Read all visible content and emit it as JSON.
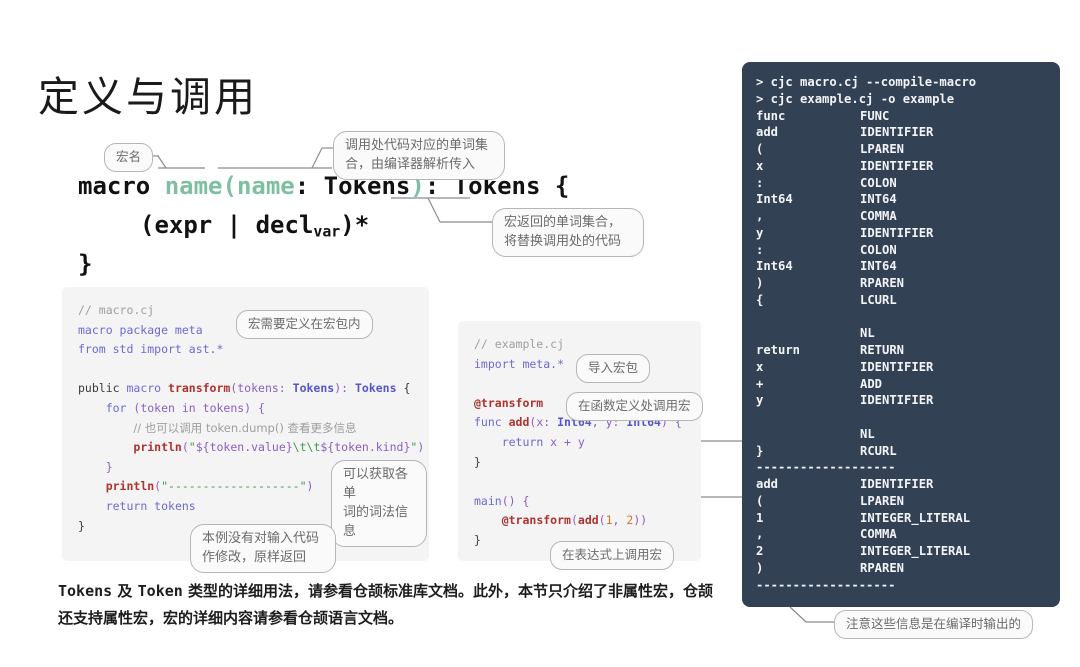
{
  "slide": {
    "title": "定义与调用",
    "background": "#ffffff"
  },
  "colors": {
    "accent_green": "#7dbfa0",
    "terminal_bg": "#334155",
    "code_panel_bg": "#f4f4f5",
    "callout_border": "#b6b6b6",
    "callout_text": "#6b6b6b"
  },
  "signature": {
    "line1": {
      "kw": "macro ",
      "name": "name",
      "lparen": "(",
      "param": "name",
      "colon": ": ",
      "type": "Tokens",
      "rparen": ")",
      "ret": ": ",
      "rettype": "Tokens",
      "brace": " {"
    },
    "line2_prefix": "(expr | decl",
    "line2_sub": "var",
    "line2_suffix": ")*",
    "line3": "}"
  },
  "callouts": {
    "macro_name": "宏名",
    "tokens_param": "调用处代码对应的单词集\n合，由编译器解析传入",
    "tokens_return": "宏返回的单词集合，\n将替换调用处的代码",
    "macro_package": "宏需要定义在宏包内",
    "token_lexinfo": "可以获取各单\n词的词法信息",
    "return_unchanged": "本例没有对输入代码\n作修改，原样返回",
    "import_pkg": "导入宏包",
    "call_at_funcdef": "在函数定义处调用宏",
    "call_at_expr": "在表达式上调用宏",
    "compile_time_note": "注意这些信息是在编译时输出的"
  },
  "code_left": {
    "filename_comment": "// macro.cj",
    "lines": [
      "// macro.cj",
      "macro package meta",
      "from std import ast.*",
      "",
      "public macro transform(tokens: Tokens): Tokens {",
      "    for (token in tokens) {",
      "        // 也可以调用 token.dump() 查看更多信息",
      "        println(\"${token.value}\\t\\t${token.kind}\")",
      "    }",
      "    println(\"-------------------\")",
      "    return tokens",
      "}"
    ]
  },
  "code_mid": {
    "filename_comment": "// example.cj",
    "lines": [
      "// example.cj",
      "import meta.*",
      "",
      "@transform",
      "func add(x: Int64, y: Int64) {",
      "    return x + y",
      "}",
      "",
      "main() {",
      "    @transform(add(1, 2))",
      "}"
    ]
  },
  "terminal": {
    "commands": [
      "> cjc macro.cj --compile-macro",
      "> cjc example.cj -o example"
    ],
    "rows": [
      {
        "token": "func",
        "kind": "FUNC"
      },
      {
        "token": "add",
        "kind": "IDENTIFIER"
      },
      {
        "token": "(",
        "kind": "LPAREN"
      },
      {
        "token": "x",
        "kind": "IDENTIFIER"
      },
      {
        "token": ":",
        "kind": "COLON"
      },
      {
        "token": "Int64",
        "kind": "INT64"
      },
      {
        "token": ",",
        "kind": "COMMA"
      },
      {
        "token": "y",
        "kind": "IDENTIFIER"
      },
      {
        "token": ":",
        "kind": "COLON"
      },
      {
        "token": "Int64",
        "kind": "INT64"
      },
      {
        "token": ")",
        "kind": "RPAREN"
      },
      {
        "token": "{",
        "kind": "LCURL"
      },
      {
        "token": "",
        "kind": ""
      },
      {
        "token": "",
        "kind": "NL"
      },
      {
        "token": "return",
        "kind": "RETURN"
      },
      {
        "token": "x",
        "kind": "IDENTIFIER"
      },
      {
        "token": "+",
        "kind": "ADD"
      },
      {
        "token": "y",
        "kind": "IDENTIFIER"
      },
      {
        "token": "",
        "kind": ""
      },
      {
        "token": "",
        "kind": "NL"
      },
      {
        "token": "}",
        "kind": "RCURL"
      },
      {
        "token": "-------------------",
        "kind": "",
        "separator": true
      },
      {
        "token": "add",
        "kind": "IDENTIFIER"
      },
      {
        "token": "(",
        "kind": "LPAREN"
      },
      {
        "token": "1",
        "kind": "INTEGER_LITERAL"
      },
      {
        "token": ",",
        "kind": "COMMA"
      },
      {
        "token": "2",
        "kind": "INTEGER_LITERAL"
      },
      {
        "token": ")",
        "kind": "RPAREN"
      },
      {
        "token": "-------------------",
        "kind": "",
        "separator": true
      }
    ]
  },
  "bottom_note": {
    "segments": [
      {
        "text": "Tokens",
        "style": "mono"
      },
      {
        "text": " 及 ",
        "style": "plain"
      },
      {
        "text": "Token",
        "style": "mono"
      },
      {
        "text": " 类型的详细用法，请参看仓颉标准库文档。此外，本节只介绍了",
        "style": "plain"
      },
      {
        "text": "非属性宏",
        "style": "bold"
      },
      {
        "text": "，仓颉还支持",
        "style": "plain"
      },
      {
        "text": "属性宏",
        "style": "bold"
      },
      {
        "text": "，宏的详细内容请参看仓颉语言文档。",
        "style": "plain"
      }
    ],
    "full_text": "Tokens 及 Token 类型的详细用法，请参看仓颉标准库文档。此外，本节只介绍了非属性宏，仓颉还支持属性宏，宏的详细内容请参看仓颉语言文档。"
  }
}
